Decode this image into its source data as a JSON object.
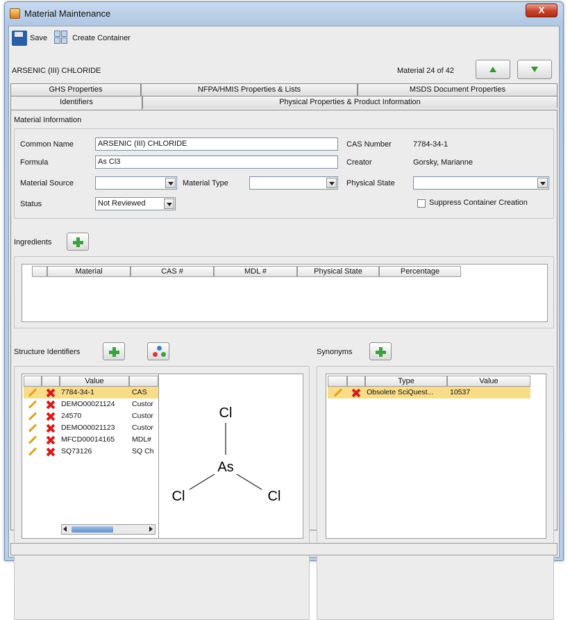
{
  "window": {
    "title": "Material Maintenance",
    "close_label": "X"
  },
  "toolbar": {
    "save_label": "Save",
    "create_container_label": "Create Container"
  },
  "header": {
    "material_name": "ARSENIC (III) CHLORIDE",
    "material_count": "Material 24 of 42"
  },
  "tabs": {
    "row1": [
      "GHS Properties",
      "NFPA/HMIS Properties & Lists",
      "MSDS Document Properties"
    ],
    "row2": [
      "Identifiers",
      "Physical Properties & Product Information"
    ],
    "active": "Identifiers"
  },
  "material_info": {
    "section_label": "Material Information",
    "common_name_label": "Common Name",
    "common_name_value": "ARSENIC (III) CHLORIDE",
    "formula_label": "Formula",
    "formula_value": "As Cl3",
    "material_source_label": "Material Source",
    "material_type_label": "Material Type",
    "physical_state_label": "Physical State",
    "status_label": "Status",
    "status_value": "Not Reviewed",
    "cas_number_label": "CAS Number",
    "cas_number_value": "7784-34-1",
    "creator_label": "Creator",
    "creator_value": "Gorsky, Marianne",
    "suppress_label": "Suppress Container Creation"
  },
  "ingredients": {
    "label": "Ingredients",
    "columns": [
      "Material",
      "CAS #",
      "MDL #",
      "Physical State",
      "Percentage"
    ]
  },
  "structure_identifiers": {
    "label": "Structure Identifiers",
    "columns": [
      "Value",
      ""
    ],
    "rows": [
      {
        "value": "7784-34-1",
        "type": "CAS"
      },
      {
        "value": "DEMO00021124",
        "type": "Custor"
      },
      {
        "value": "24570",
        "type": "Custor"
      },
      {
        "value": "DEMO00021123",
        "type": "Custor"
      },
      {
        "value": "MFCD00014165",
        "type": "MDL#"
      },
      {
        "value": "SQ73126",
        "type": "SQ Ch"
      }
    ],
    "molecule": {
      "center": "As",
      "top": "Cl",
      "left": "Cl",
      "right": "Cl"
    }
  },
  "synonyms": {
    "label": "Synonyms",
    "columns": [
      "Type",
      "Value"
    ],
    "rows": [
      {
        "type": "Obsolete SciQuest...",
        "value": "10537"
      }
    ]
  },
  "colors": {
    "accent_green": "#3aa33a",
    "selection": "#f9dc88",
    "delete_red": "#d61d1d",
    "edit_orange": "#e0a21c"
  }
}
